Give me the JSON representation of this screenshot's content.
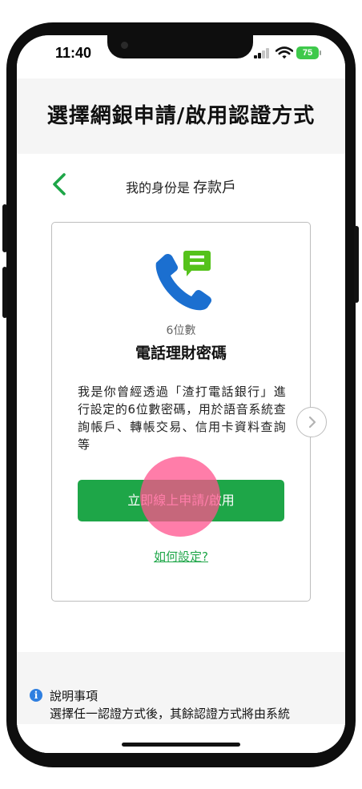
{
  "status_bar": {
    "time": "11:40",
    "battery": "75",
    "colors": {
      "battery": "#3ec94b"
    }
  },
  "header": {
    "title": "選擇網銀申請/啟用認證方式"
  },
  "identity": {
    "prefix": "我的身份是",
    "type": "存款戶",
    "back_icon": "chevron-left-icon"
  },
  "card": {
    "icon": "phone-message-icon",
    "subtitle": "6位數",
    "title": "電話理財密碼",
    "description": "我是你曾經透過「渣打電話銀行」進行設定的6位數密碼，用於語音系統查詢帳戶、轉帳交易、信用卡資料查詢等",
    "apply_button": "立即線上申請/啟用",
    "howto_link": "如何設定?",
    "next_icon": "chevron-right-circle-icon"
  },
  "notes": {
    "title": "說明事項",
    "text": "選擇任一認證方式後，其餘認證方式將由系統"
  },
  "theme": {
    "accent": "#1ea648",
    "phone_blue": "#1b6fd0",
    "chat_green": "#55c21b",
    "info_blue": "#2f7fe0"
  }
}
